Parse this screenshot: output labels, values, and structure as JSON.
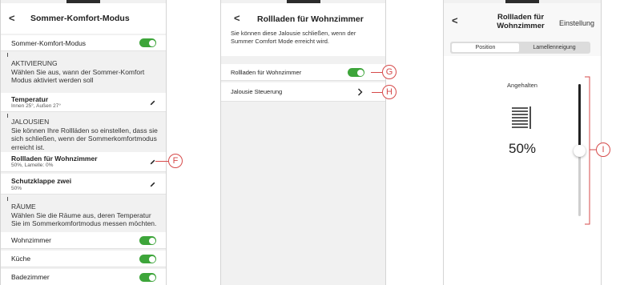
{
  "screen1": {
    "title": "Sommer-Komfort-Modus",
    "back_label": "<",
    "mode_toggle_label": "Sommer-Komfort-Modus",
    "activation": {
      "heading": "AKTIVIERUNG",
      "description": "Wählen Sie aus, wann der Sommer-Komfort Modus aktiviert werden soll"
    },
    "temperature": {
      "label": "Temperatur",
      "value": "Innen 25°, Außen 27°"
    },
    "blinds": {
      "heading": "JALOUSIEN",
      "description": "Sie können Ihre Rollläden so einstellen, dass sie sich schließen, wenn der Sommerkomfortmodus erreicht ist."
    },
    "blind_items": [
      {
        "label": "Rollladen für Wohnzimmer",
        "value": "50%, Lamelle: 0%"
      },
      {
        "label": "Schutzklappe zwei",
        "value": "50%"
      }
    ],
    "rooms": {
      "heading": "RÄUME",
      "description": "Wählen Sie die Räume aus, deren Temperatur Sie im Sommerkomfortmodus messen möchten."
    },
    "room_items": [
      {
        "label": "Wohnzimmer",
        "enabled": true
      },
      {
        "label": "Küche",
        "enabled": true
      },
      {
        "label": "Badezimmer",
        "enabled": true
      }
    ],
    "callout": "F"
  },
  "screen2": {
    "title": "Rollladen für Wohnzimmer",
    "back_label": "<",
    "description": "Sie können diese Jalousie schließen, wenn der Summer Comfort Mode erreicht wird.",
    "toggle_label": "Rollladen für Wohnzimmer",
    "toggle_enabled": true,
    "control_label": "Jalousie Steuerung",
    "callout_toggle": "G",
    "callout_control": "H"
  },
  "screen3": {
    "title_line1": "Rollladen für",
    "title_line2": "Wohnzimmer",
    "back_label": "<",
    "settings_label": "Einstellung",
    "tabs": [
      "Position",
      "Lamellenneigung"
    ],
    "active_tab": "Position",
    "status": "Angehalten",
    "percent": "50%",
    "position_fraction": 0.5,
    "callout": "I"
  },
  "colors": {
    "accent_green": "#3da53a",
    "callout_red": "#d64a4a"
  }
}
